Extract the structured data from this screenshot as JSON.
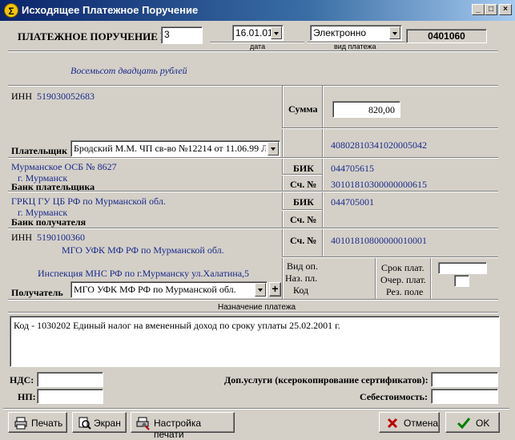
{
  "window": {
    "title": "Исходящее Платежное Поручение",
    "icon_letter": "Σ"
  },
  "header": {
    "doc_label": "ПЛАТЕЖНОЕ ПОРУЧЕНИЕ  №",
    "doc_number": "3",
    "date_value": "16.01.01",
    "date_caption": "дата",
    "payment_type_value": "Электронно",
    "payment_type_caption": "вид платежа",
    "form_code": "0401060"
  },
  "amount_words": "Восемьсот двадцать  рублей",
  "payer": {
    "inn_label": "ИНН",
    "inn_value": "519030052683",
    "label": "Плательщик",
    "value": "Бродский М.М. ЧП св-во №12214 от 11.06.99 Л",
    "account": "40802810341020005042"
  },
  "sum": {
    "label": "Сумма",
    "value": "820,00"
  },
  "payer_bank": {
    "name": "Мурманское ОСБ № 8627",
    "city": "г. Мурманск",
    "label": "Банк плательщика",
    "bik_label": "БИК",
    "bik_value": "044705615",
    "corr_label": "Сч. №",
    "corr_value": "30101810300000000615"
  },
  "payee_bank": {
    "name": "ГРКЦ ГУ ЦБ РФ по Мурманской обл.",
    "city": "г. Мурманск",
    "label": "Банк получателя",
    "bik_label": "БИК",
    "bik_value": "044705001",
    "corr_label": "Сч. №",
    "corr_value": ""
  },
  "payee": {
    "inn_label": "ИНН",
    "inn_value": "5190100360",
    "line1": "МГО УФК МФ РФ по Мурманской обл.",
    "line2": "Инспекция МНС РФ по г.Мурманску ул.Халатина,5",
    "label": "Получатель",
    "value": "МГО УФК МФ РФ по Мурманской обл.",
    "account_label": "Сч. №",
    "account_value": "40101810800000010001",
    "add_symbol": "+"
  },
  "codes": {
    "vid_op": "Вид оп.",
    "naz_pl": "Наз. пл.",
    "kod": "Код",
    "srok": "Срок плат.",
    "ocher": "Очер. плат.",
    "rez": "Рез. поле"
  },
  "purpose": {
    "caption": "Назначение платежа",
    "text": "Код - 1030202 Единый налог на вмененный доход по сроку уплаты 25.02.2001 г."
  },
  "footer": {
    "nds_label": "НДС:",
    "np_label": "НП:",
    "extra_label": "Доп.услуги (ксерокопирование сертификатов):",
    "cost_label": "Себестоимость:"
  },
  "buttons": {
    "print": "Печать",
    "screen": "Экран",
    "print_setup": "Настройка печати",
    "cancel": "Отмена",
    "ok": "OK"
  },
  "colors": {
    "value_text": "#1a2a8a",
    "titlebar": "#0a246a",
    "window_bg": "#d4d0c8"
  }
}
